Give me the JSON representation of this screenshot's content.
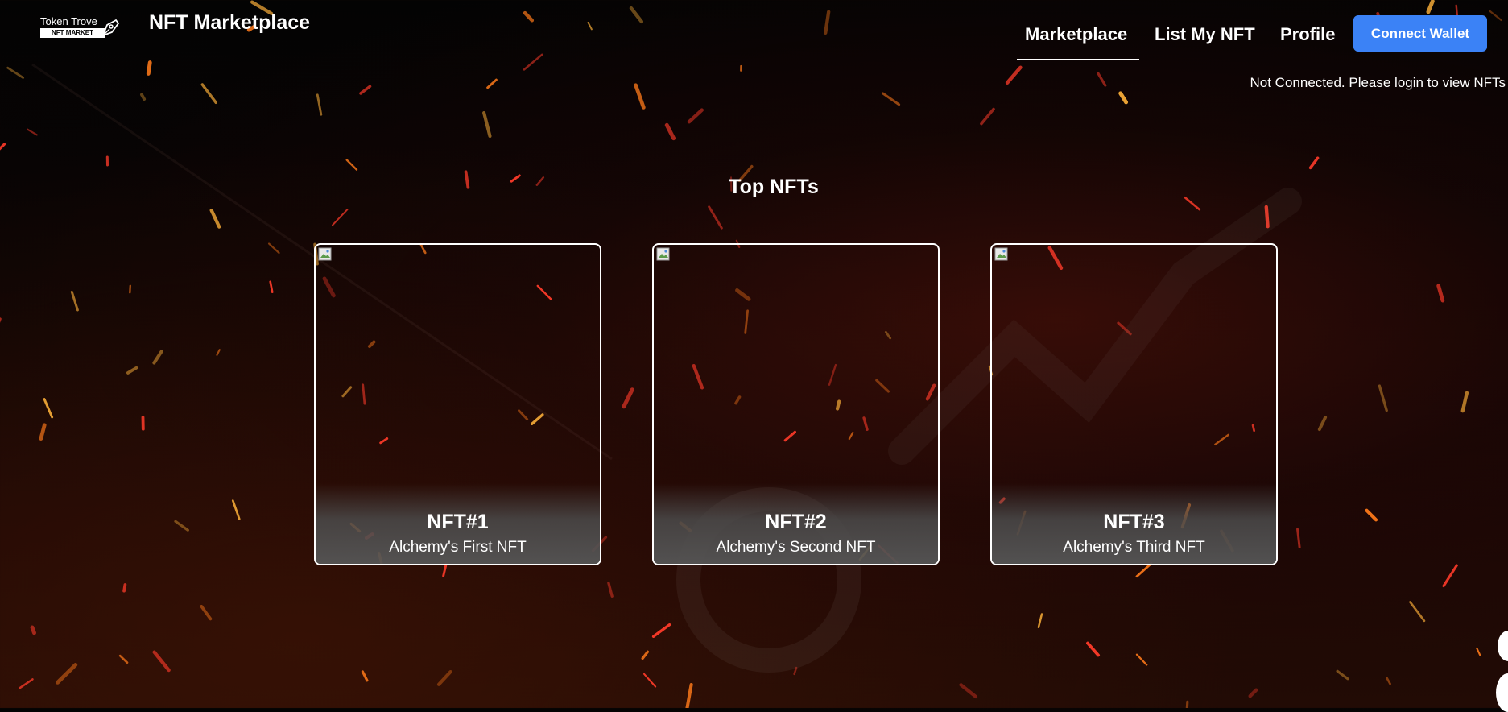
{
  "header": {
    "logo_text": "Token Trove",
    "logo_subtext": "NFT MARKET",
    "site_title": "NFT Marketplace",
    "nav": [
      {
        "label": "Marketplace",
        "active": true
      },
      {
        "label": "List My NFT",
        "active": false
      },
      {
        "label": "Profile",
        "active": false
      }
    ],
    "connect_button": "Connect Wallet",
    "status_text": "Not Connected. Please login to view NFTs"
  },
  "main": {
    "section_title": "Top NFTs",
    "cards": [
      {
        "name": "NFT#1",
        "description": "Alchemy's First NFT"
      },
      {
        "name": "NFT#2",
        "description": "Alchemy's Second NFT"
      },
      {
        "name": "NFT#3",
        "description": "Alchemy's Third NFT"
      }
    ]
  },
  "colors": {
    "accent": "#3b82f6",
    "card_border": "#ffffff"
  }
}
